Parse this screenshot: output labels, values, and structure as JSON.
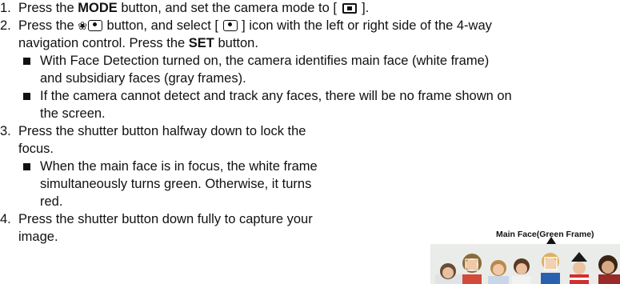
{
  "doc": {
    "step1": {
      "num": "1.",
      "a": "Press the ",
      "mode": "MODE",
      "b": " button, and set the camera mode to [ ",
      "c": " ]."
    },
    "step2": {
      "num": "2.",
      "a": "Press the ",
      "b": " button, and select [ ",
      "c": " ] icon with the left or right side of the 4-way",
      "line2a": "navigation control. Press the ",
      "set": "SET",
      "line2b": " button."
    },
    "bullet1": {
      "l1": "With Face Detection turned on, the camera identifies main face (white frame)",
      "l2": "and subsidiary faces (gray frames)."
    },
    "bullet2": {
      "l1": "If the camera cannot detect and track any faces, there will be no frame shown on",
      "l2": "the screen."
    },
    "step3": {
      "num": "3.",
      "l1": "Press the shutter button halfway down to lock the",
      "l2": "focus."
    },
    "bullet3": {
      "l1": "When the main face is in focus, the white frame",
      "l2": "simultaneously turns green. Otherwise, it turns",
      "l3": "red."
    },
    "step4": {
      "num": "4.",
      "l1": "Press the shutter button down fully to capture your",
      "l2": "image."
    }
  },
  "figure": {
    "label": "Main Face(Green Frame)"
  }
}
